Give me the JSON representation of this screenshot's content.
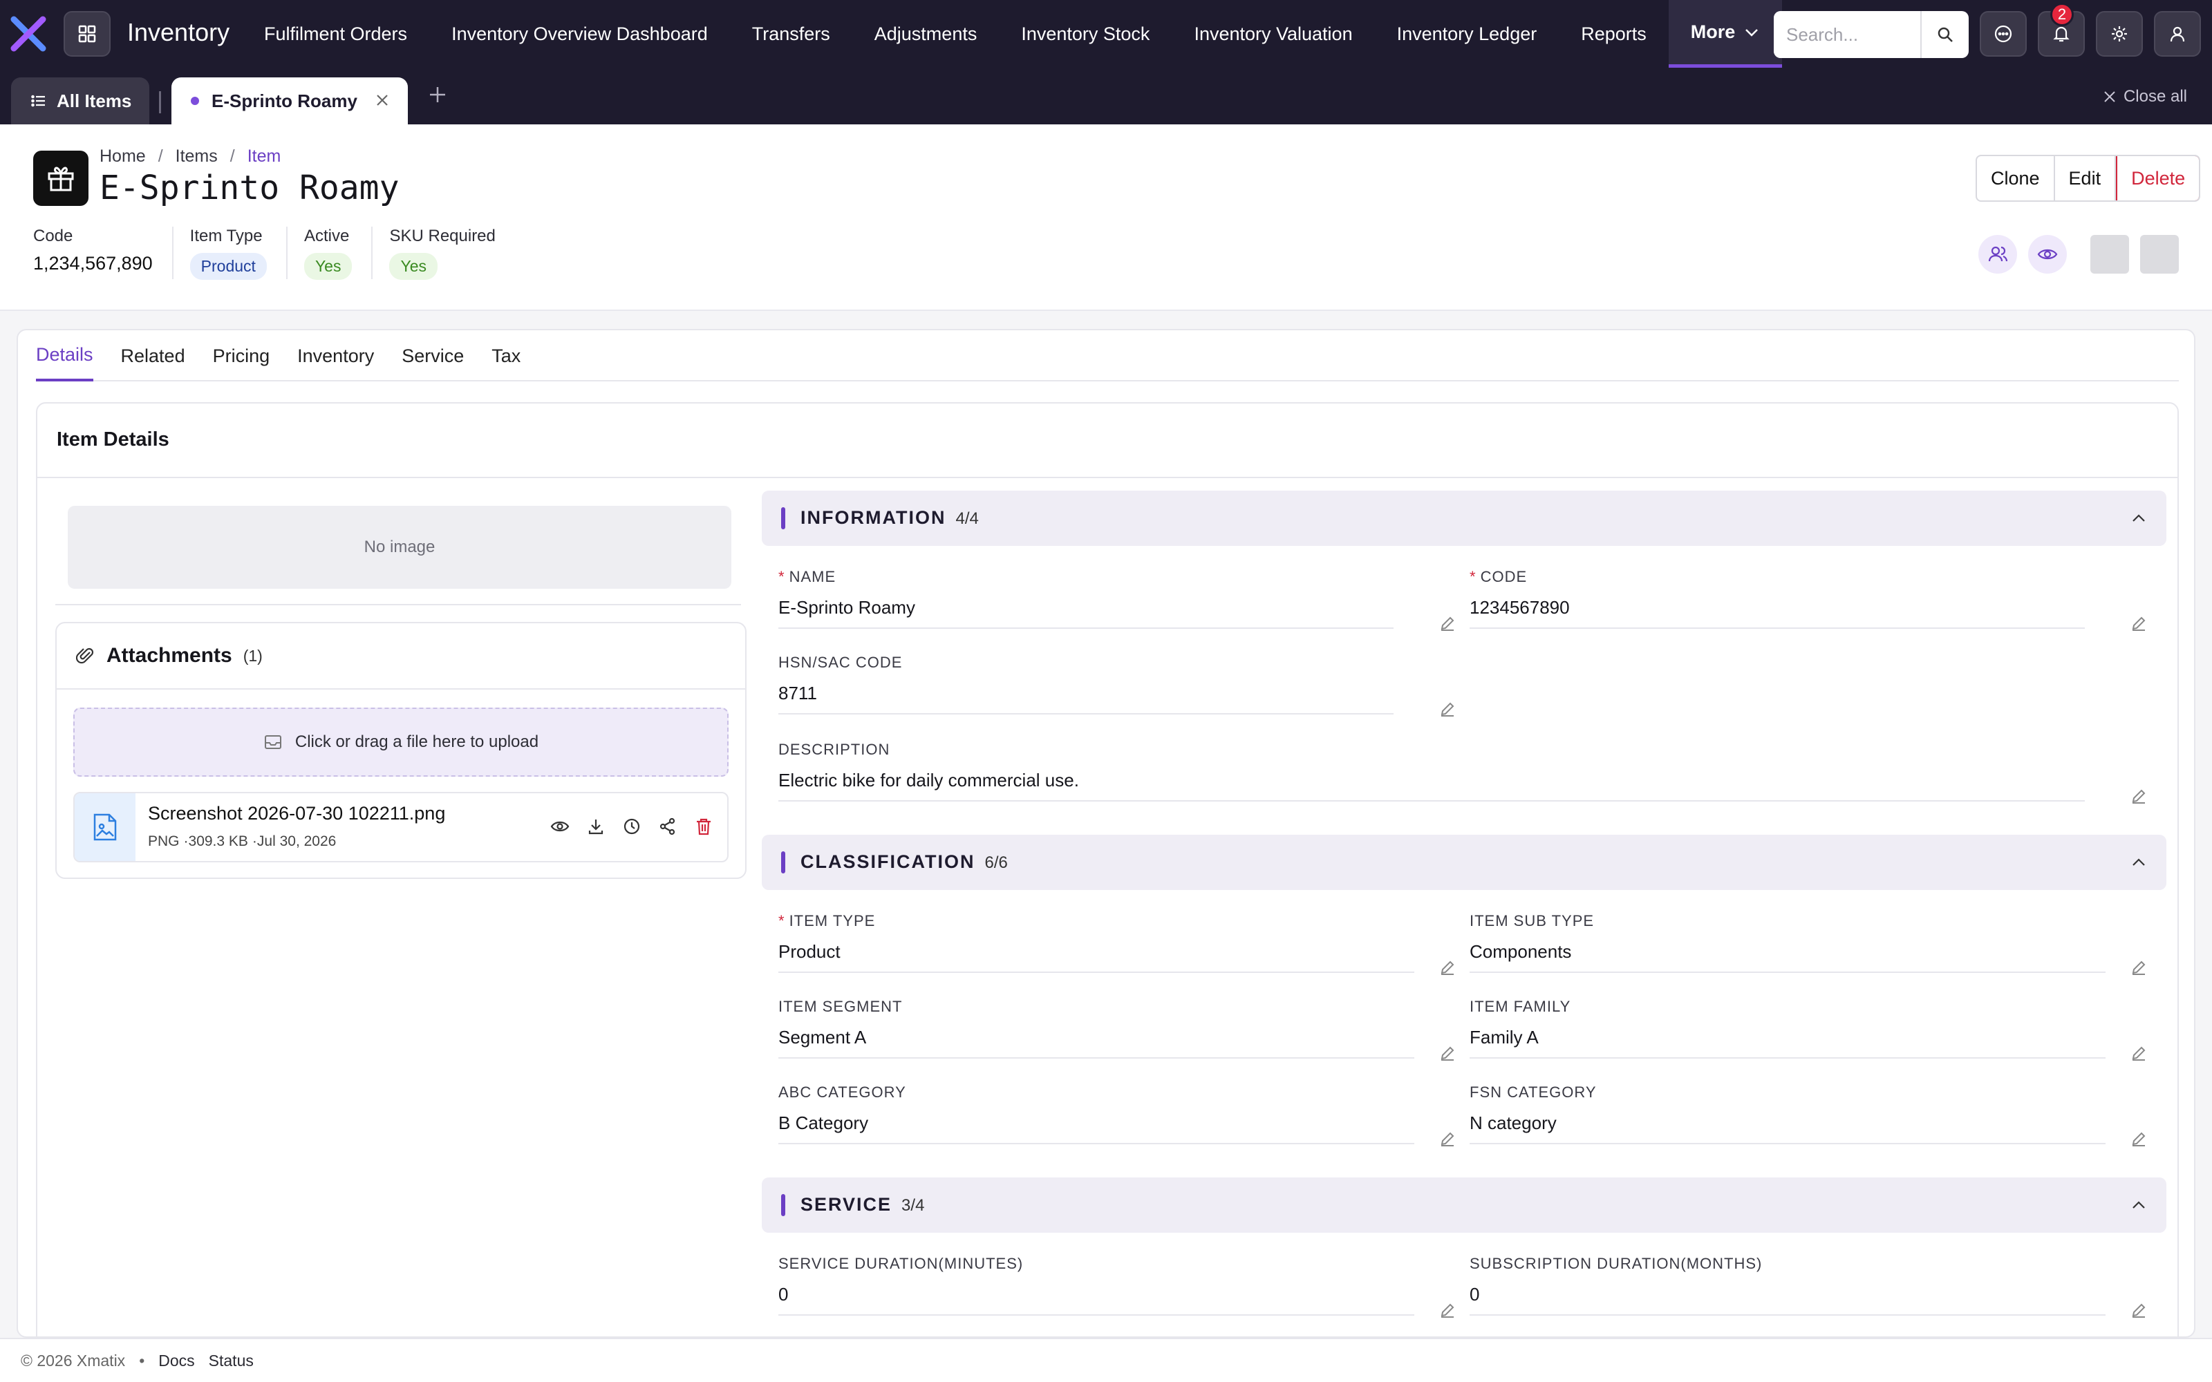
{
  "app": {
    "title": "Inventory",
    "nav": [
      "Fulfilment Orders",
      "Inventory Overview Dashboard",
      "Transfers",
      "Adjustments",
      "Inventory Stock",
      "Inventory Valuation",
      "Inventory Ledger",
      "Reports"
    ],
    "more_label": "More",
    "search_placeholder": "Search...",
    "notification_count": "2"
  },
  "tabs": {
    "all_items": "All Items",
    "active_tab": "E-Sprinto Roamy",
    "close_all": "Close all"
  },
  "header": {
    "breadcrumb": [
      "Home",
      "Items",
      "Item"
    ],
    "title": "E-Sprinto Roamy",
    "meta": {
      "code_label": "Code",
      "code_value": "1,234,567,890",
      "type_label": "Item Type",
      "type_value": "Product",
      "active_label": "Active",
      "active_value": "Yes",
      "sku_label": "SKU Required",
      "sku_value": "Yes"
    },
    "actions": {
      "clone": "Clone",
      "edit": "Edit",
      "delete": "Delete"
    }
  },
  "detail_tabs": [
    "Details",
    "Related",
    "Pricing",
    "Inventory",
    "Service",
    "Tax"
  ],
  "card": {
    "title": "Item Details",
    "no_image": "No image",
    "attachments": {
      "title": "Attachments",
      "count": "(1)",
      "upload_text": "Click or drag a file here to upload",
      "file": {
        "name": "Screenshot 2026-07-30 102211.png",
        "type": "PNG",
        "size": "·309.3 KB",
        "date": "·Jul 30, 2026"
      }
    }
  },
  "sections": {
    "information": {
      "title": "INFORMATION",
      "count": "4/4",
      "name_label": "NAME",
      "name_value": "E-Sprinto Roamy",
      "code_label": "CODE",
      "code_value": "1234567890",
      "hsn_label": "HSN/SAC CODE",
      "hsn_value": "8711",
      "desc_label": "DESCRIPTION",
      "desc_value": "Electric bike for daily commercial use."
    },
    "classification": {
      "title": "CLASSIFICATION",
      "count": "6/6",
      "type_label": "ITEM TYPE",
      "type_value": "Product",
      "subtype_label": "ITEM SUB TYPE",
      "subtype_value": "Components",
      "segment_label": "ITEM SEGMENT",
      "segment_value": "Segment A",
      "family_label": "ITEM FAMILY",
      "family_value": "Family A",
      "abc_label": "ABC CATEGORY",
      "abc_value": "B Category",
      "fsn_label": "FSN CATEGORY",
      "fsn_value": "N category"
    },
    "service": {
      "title": "SERVICE",
      "count": "3/4",
      "duration_label": "SERVICE DURATION(MINUTES)",
      "duration_value": "0",
      "subscription_label": "SUBSCRIPTION DURATION(MONTHS)",
      "subscription_value": "0"
    }
  },
  "footer": {
    "copyright": "© 2026 Xmatix",
    "dot": "•",
    "docs": "Docs",
    "status": "Status"
  },
  "colors": {
    "accent": "#6b3fc4",
    "topbar": "#1e1b2e",
    "danger": "#d1263b"
  }
}
